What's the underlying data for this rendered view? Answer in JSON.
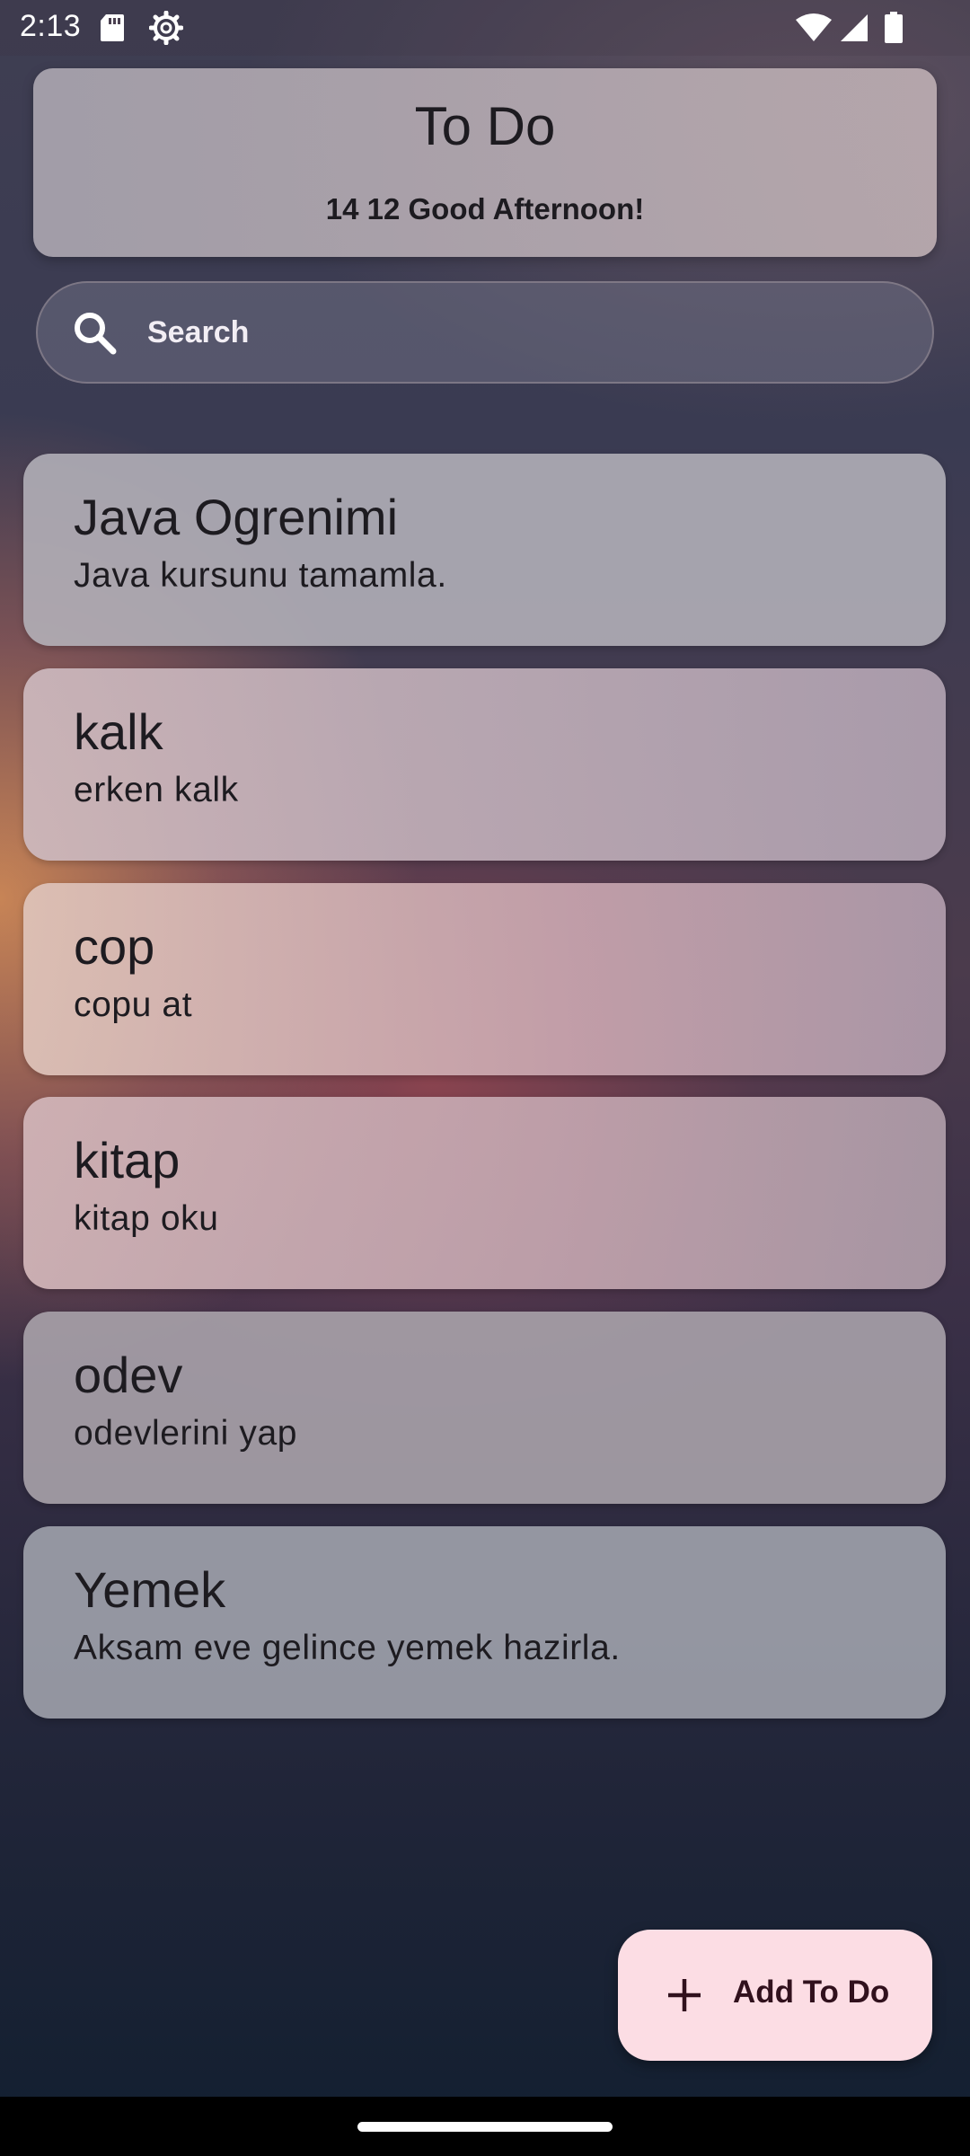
{
  "status_bar": {
    "time": "2:13",
    "icons": [
      "sd-card-icon",
      "settings-icon",
      "wifi-icon",
      "signal-icon",
      "battery-icon"
    ]
  },
  "header": {
    "title": "To Do",
    "greeting": "14 12 Good Afternoon!"
  },
  "search": {
    "placeholder": "Search",
    "value": "",
    "icon": "search-icon"
  },
  "todos": [
    {
      "title": "Java Ogrenimi",
      "description": "Java kursunu tamamla."
    },
    {
      "title": "kalk",
      "description": "erken kalk"
    },
    {
      "title": "cop",
      "description": "copu at"
    },
    {
      "title": "kitap",
      "description": "kitap oku"
    },
    {
      "title": "odev",
      "description": "odevlerini yap"
    },
    {
      "title": "Yemek",
      "description": "Aksam eve gelince yemek hazirla."
    }
  ],
  "fab": {
    "label": "Add To Do",
    "icon": "plus-icon",
    "background": "#fcdde4",
    "text_color": "#31111d"
  }
}
